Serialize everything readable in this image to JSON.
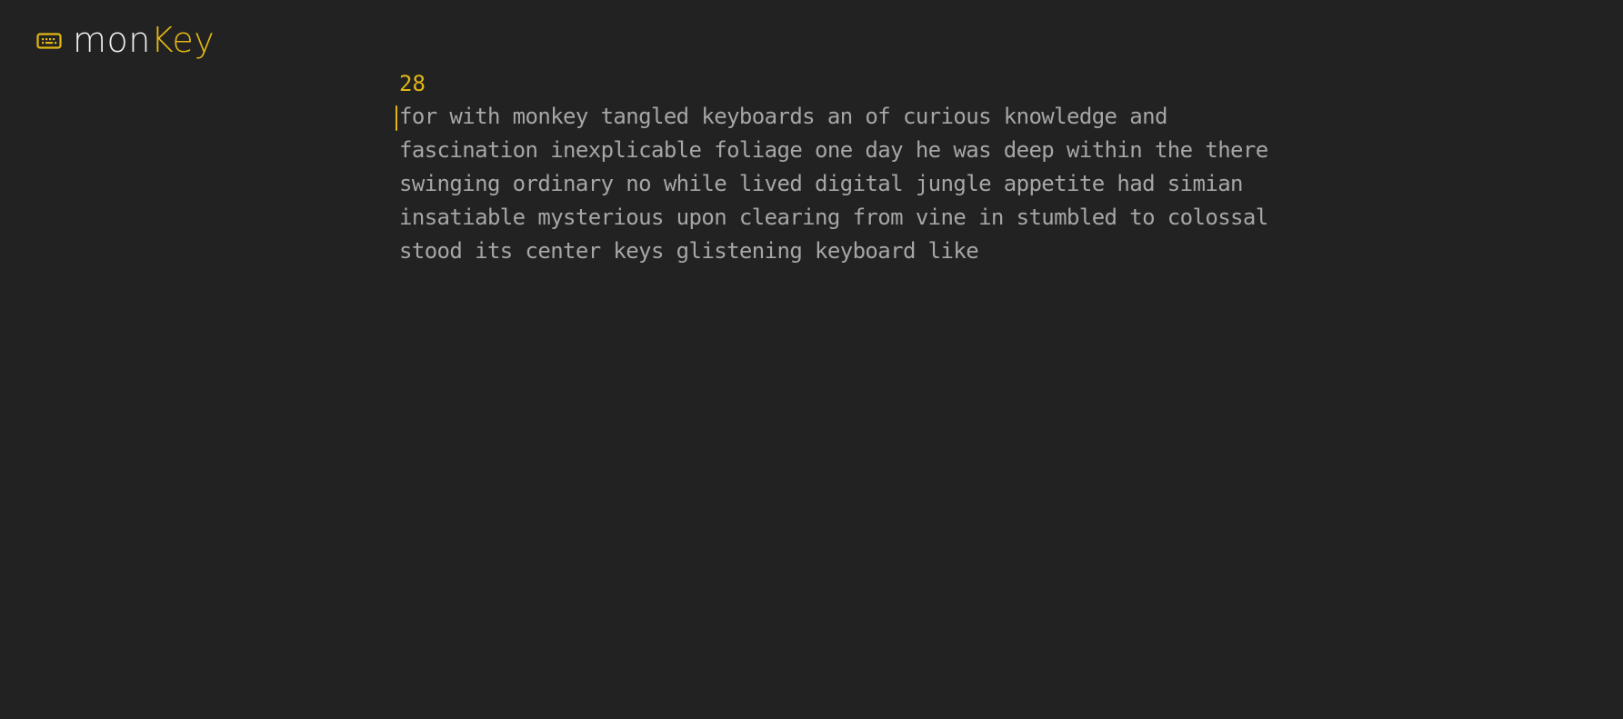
{
  "app": {
    "logo_icon": "keyboard-icon",
    "logo_part1": "mon",
    "logo_part2": "Key"
  },
  "test": {
    "word_count": "28",
    "lines": [
      "for with monkey tangled keyboards an of curious knowledge and",
      "fascination inexplicable foliage one day he was deep within the there",
      "swinging ordinary no while lived digital jungle appetite had simian",
      "insatiable mysterious upon clearing from vine in stumbled to colossal",
      "stood its center keys glistening keyboard like"
    ]
  },
  "colors": {
    "background": "#222222",
    "accent": "#e2b714",
    "text": "#a6a6a6",
    "logo_text": "#f1f1f1"
  }
}
